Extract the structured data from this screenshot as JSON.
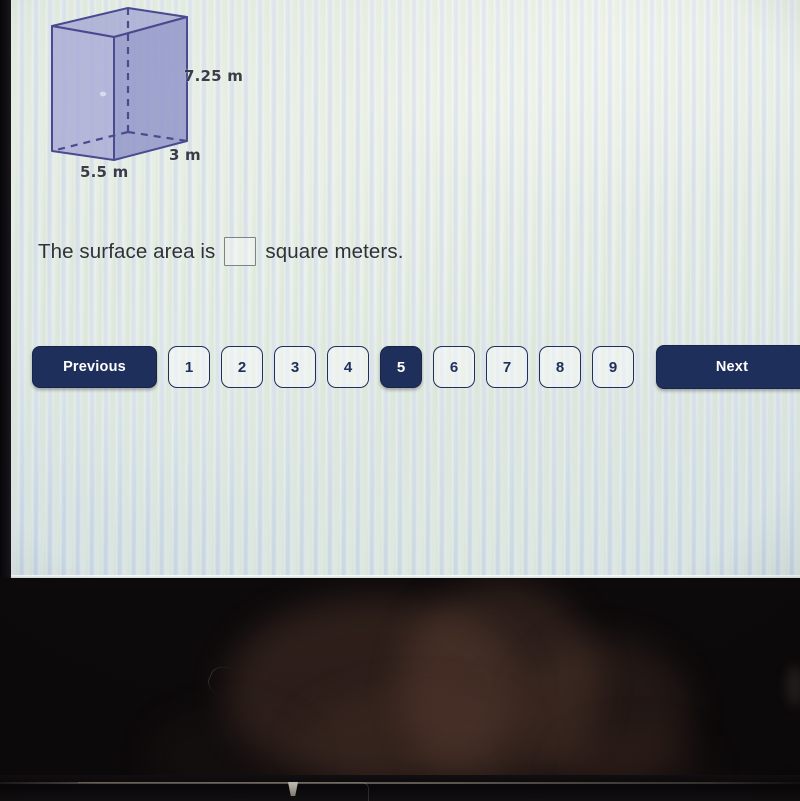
{
  "figure": {
    "shape_name": "rectangular-prism",
    "height_label": "7.25 m",
    "depth_label": "3 m",
    "width_label": "5.5 m",
    "fill_color": "#9b9fd0",
    "edge_color": "#4b4a8e"
  },
  "question": {
    "prefix": "The surface area is",
    "suffix": "square meters.",
    "answer_value": "",
    "answer_placeholder": ""
  },
  "pager": {
    "previous_label": "Previous",
    "next_label": "Next",
    "pages": [
      "1",
      "2",
      "3",
      "4",
      "5",
      "6",
      "7",
      "8",
      "9"
    ],
    "active_page": "5",
    "accent_color": "#1e2f5c"
  }
}
